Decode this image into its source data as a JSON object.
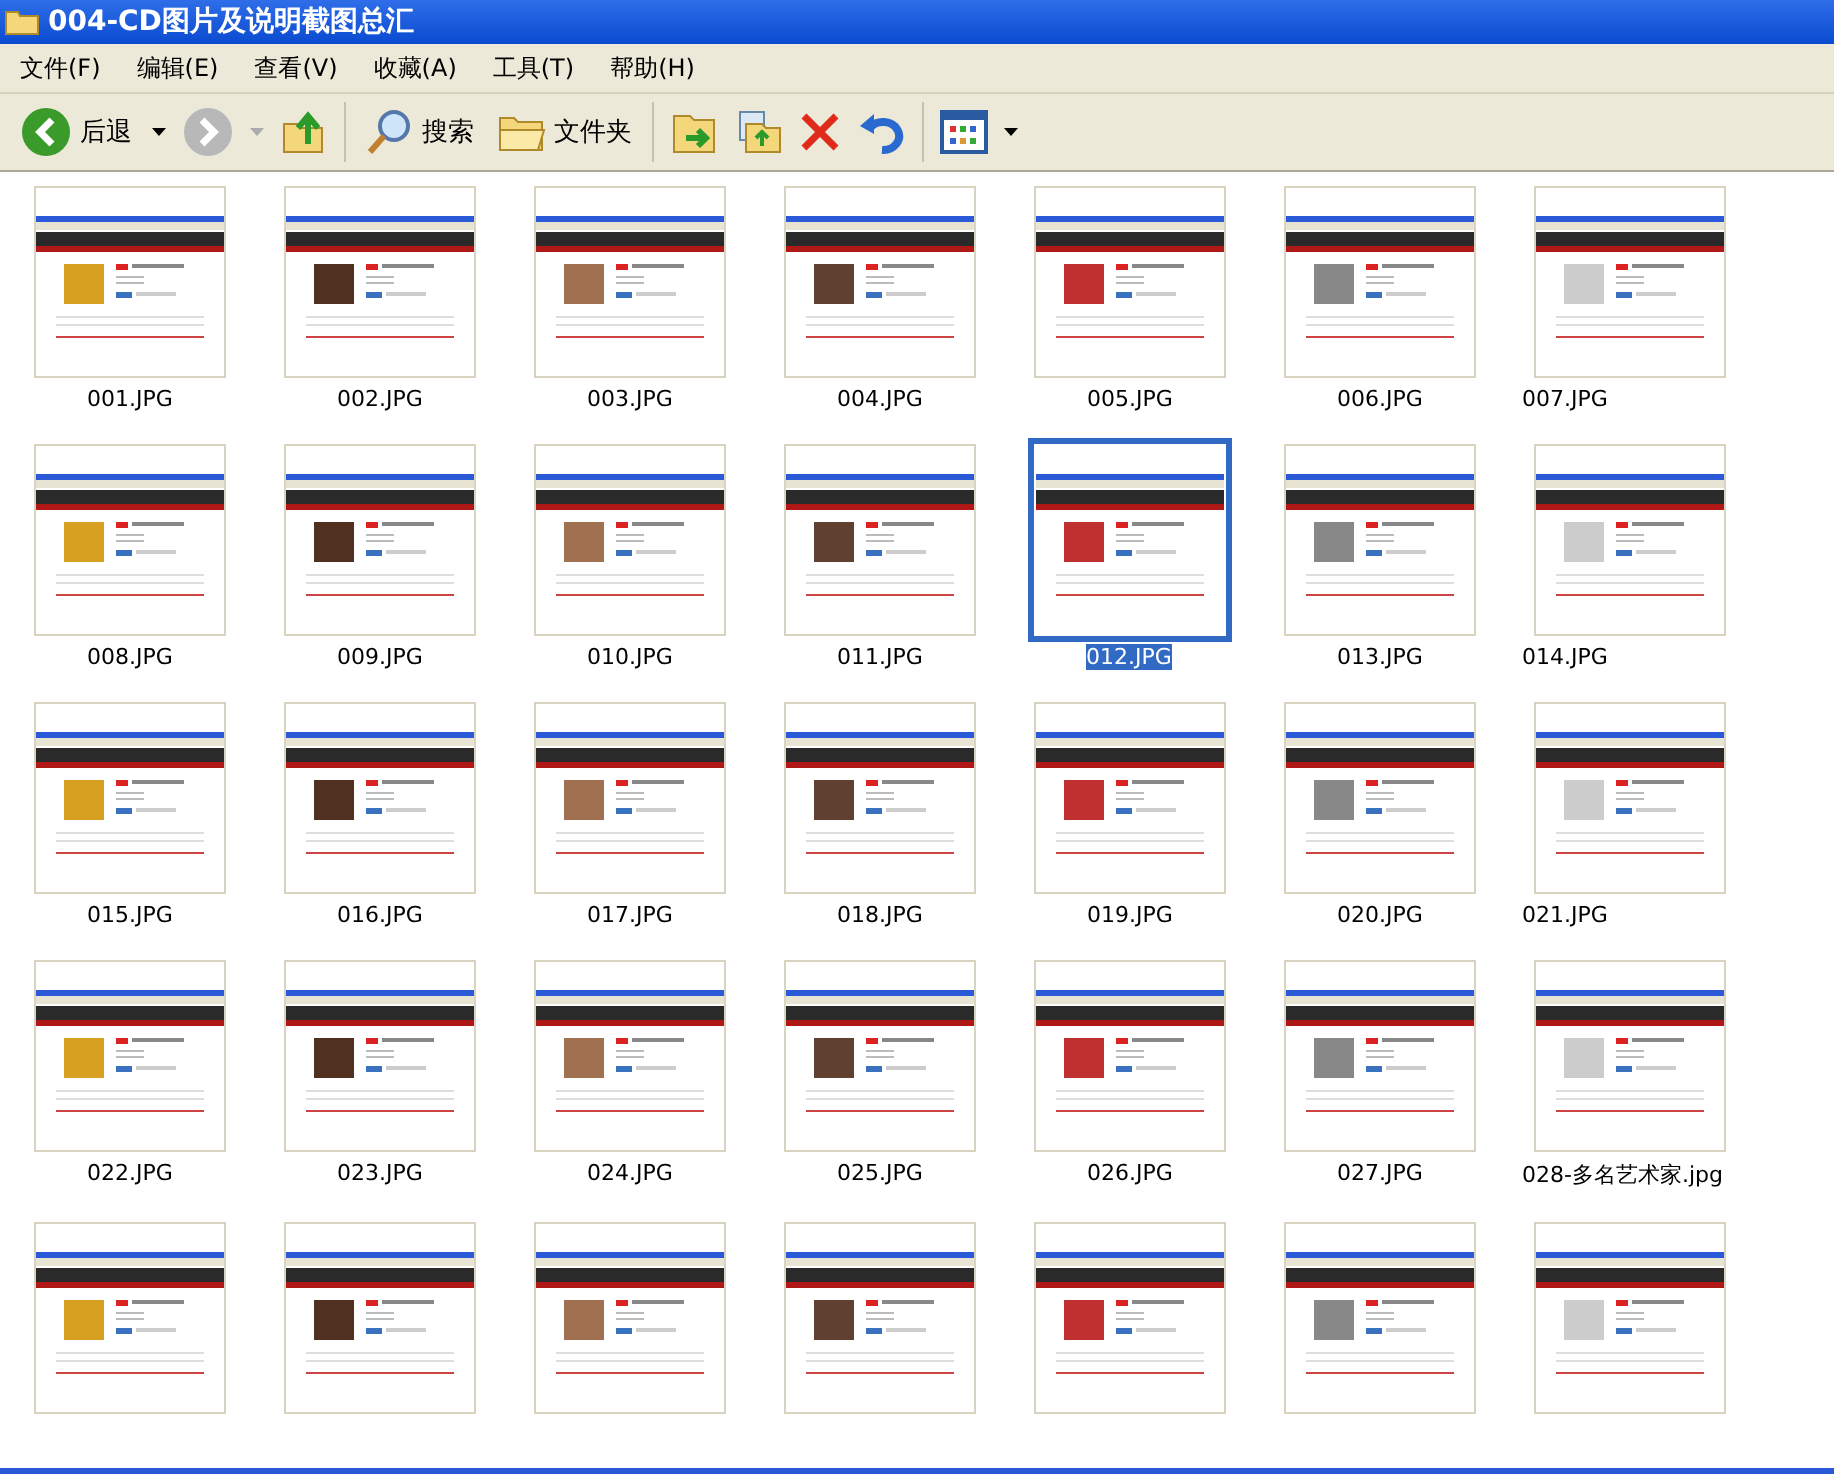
{
  "window": {
    "title": "004-CD图片及说明截图总汇"
  },
  "menu": [
    "文件(F)",
    "编辑(E)",
    "查看(V)",
    "收藏(A)",
    "工具(T)",
    "帮助(H)"
  ],
  "toolbar": {
    "back": "后退",
    "search": "搜索",
    "folders": "文件夹"
  },
  "files": [
    {
      "label": "001.JPG",
      "selected": false
    },
    {
      "label": "002.JPG",
      "selected": false
    },
    {
      "label": "003.JPG",
      "selected": false
    },
    {
      "label": "004.JPG",
      "selected": false
    },
    {
      "label": "005.JPG",
      "selected": false
    },
    {
      "label": "006.JPG",
      "selected": false
    },
    {
      "label": "007.JPG",
      "selected": false
    },
    {
      "label": "008.JPG",
      "selected": false
    },
    {
      "label": "009.JPG",
      "selected": false
    },
    {
      "label": "010.JPG",
      "selected": false
    },
    {
      "label": "011.JPG",
      "selected": false
    },
    {
      "label": "012.JPG",
      "selected": true
    },
    {
      "label": "013.JPG",
      "selected": false
    },
    {
      "label": "014.JPG",
      "selected": false
    },
    {
      "label": "015.JPG",
      "selected": false
    },
    {
      "label": "016.JPG",
      "selected": false
    },
    {
      "label": "017.JPG",
      "selected": false
    },
    {
      "label": "018.JPG",
      "selected": false
    },
    {
      "label": "019.JPG",
      "selected": false
    },
    {
      "label": "020.JPG",
      "selected": false
    },
    {
      "label": "021.JPG",
      "selected": false
    },
    {
      "label": "022.JPG",
      "selected": false
    },
    {
      "label": "023.JPG",
      "selected": false
    },
    {
      "label": "024.JPG",
      "selected": false
    },
    {
      "label": "025.JPG",
      "selected": false
    },
    {
      "label": "026.JPG",
      "selected": false
    },
    {
      "label": "027.JPG",
      "selected": false
    },
    {
      "label": "028-多名艺术家.jpg",
      "selected": false
    },
    {
      "selected": false
    },
    {
      "selected": false
    },
    {
      "selected": false
    },
    {
      "selected": false
    },
    {
      "selected": false
    },
    {
      "selected": false
    },
    {
      "selected": false
    }
  ]
}
